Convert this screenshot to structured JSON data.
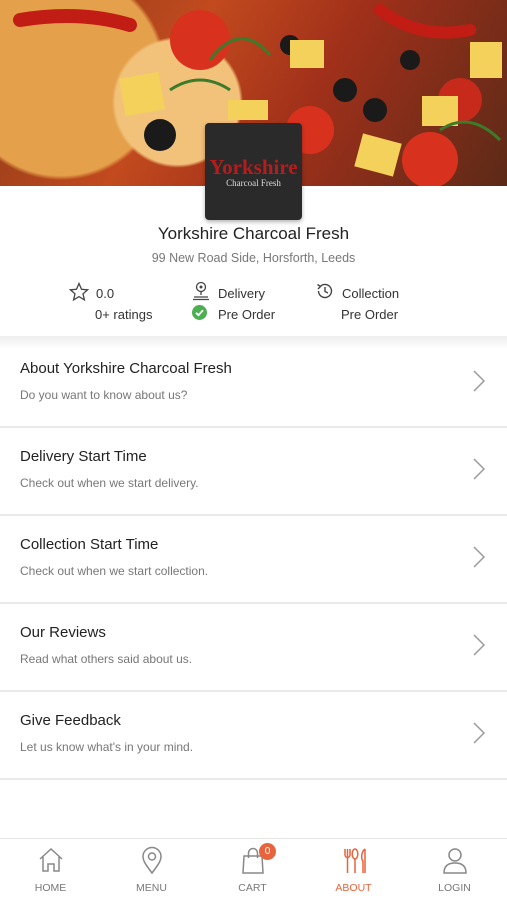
{
  "restaurant": {
    "logo_line1": "Yorkshire",
    "logo_line2": "Charcoal Fresh",
    "name": "Yorkshire Charcoal Fresh",
    "address": "99 New Road Side, Horsforth, Leeds"
  },
  "stats": {
    "rating": "0.0",
    "ratings_count": "0+ ratings",
    "delivery_label": "Delivery",
    "delivery_status": "Pre Order",
    "collection_label": "Collection",
    "collection_status": "Pre Order"
  },
  "menu_items": [
    {
      "title": "About Yorkshire Charcoal Fresh",
      "subtitle": "Do you want to know about us?"
    },
    {
      "title": "Delivery Start Time",
      "subtitle": "Check out when we start delivery."
    },
    {
      "title": "Collection Start Time",
      "subtitle": "Check out when we start collection."
    },
    {
      "title": "Our Reviews",
      "subtitle": "Read what others said about us."
    },
    {
      "title": "Give Feedback",
      "subtitle": "Let us know what's in your mind."
    }
  ],
  "tabs": {
    "home": "HOME",
    "menu": "MENU",
    "cart": "CART",
    "cart_count": "0",
    "about": "ABOUT",
    "login": "LOGIN"
  },
  "colors": {
    "accent": "#e8643c",
    "check_green": "#4caf50"
  }
}
